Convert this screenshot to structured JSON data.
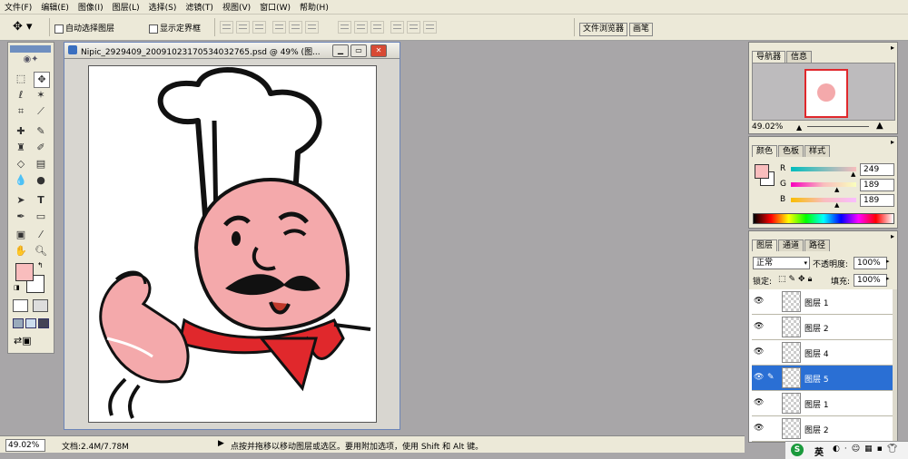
{
  "menu": [
    "文件(F)",
    "编辑(E)",
    "图像(I)",
    "图层(L)",
    "选择(S)",
    "滤镜(T)",
    "视图(V)",
    "窗口(W)",
    "帮助(H)"
  ],
  "options": {
    "auto_select_label": "自动选择图层",
    "show_bounds_label": "显示定界框",
    "well_tabs": [
      "文件浏览器",
      "画笔"
    ]
  },
  "document": {
    "title": "Nipic_2929409_20091023170534032765.psd @ 49% (图..."
  },
  "navigator": {
    "tabs": [
      "导航器",
      "信息"
    ],
    "zoom": "49.02%"
  },
  "color": {
    "tabs": [
      "颜色",
      "色板",
      "样式"
    ],
    "r_label": "R",
    "g_label": "G",
    "b_label": "B",
    "r": "249",
    "g": "189",
    "b": "189",
    "foreground": "#f9bdbd"
  },
  "layers": {
    "tabs": [
      "图层",
      "通道",
      "路径"
    ],
    "blend_mode": "正常",
    "opacity_label": "不透明度:",
    "opacity": "100%",
    "lock_label": "锁定:",
    "fill_label": "填充:",
    "fill": "100%",
    "items": [
      {
        "name": "图层 1",
        "selected": false
      },
      {
        "name": "图层 2",
        "selected": false
      },
      {
        "name": "图层 4",
        "selected": false
      },
      {
        "name": "图层 5",
        "selected": true
      },
      {
        "name": "图层 1",
        "selected": false
      },
      {
        "name": "图层 2",
        "selected": false
      }
    ]
  },
  "status": {
    "zoom": "49.02%",
    "doc_info": "文档:2.4M/7.78M",
    "hint": "点按并拖移以移动图层或选区。要用附加选项，使用 Shift 和 Alt 键。"
  },
  "taskbar": {
    "ime": "英"
  }
}
